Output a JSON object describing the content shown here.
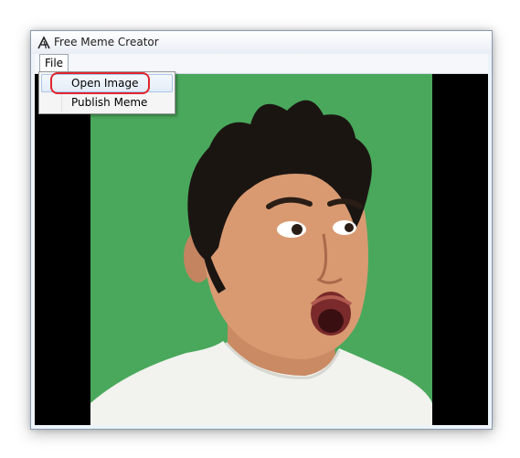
{
  "window": {
    "title": "Free Meme Creator",
    "icon": "app-logo-icon"
  },
  "menubar": {
    "file_label": "File"
  },
  "file_menu": {
    "items": [
      {
        "label": "Open Image",
        "highlighted": true
      },
      {
        "label": "Publish Meme",
        "highlighted": false
      }
    ]
  },
  "annotation": {
    "highlight_color": "#e0262d"
  },
  "canvas": {
    "background_color": "#000000",
    "image_background_color": "#4aa85c"
  }
}
